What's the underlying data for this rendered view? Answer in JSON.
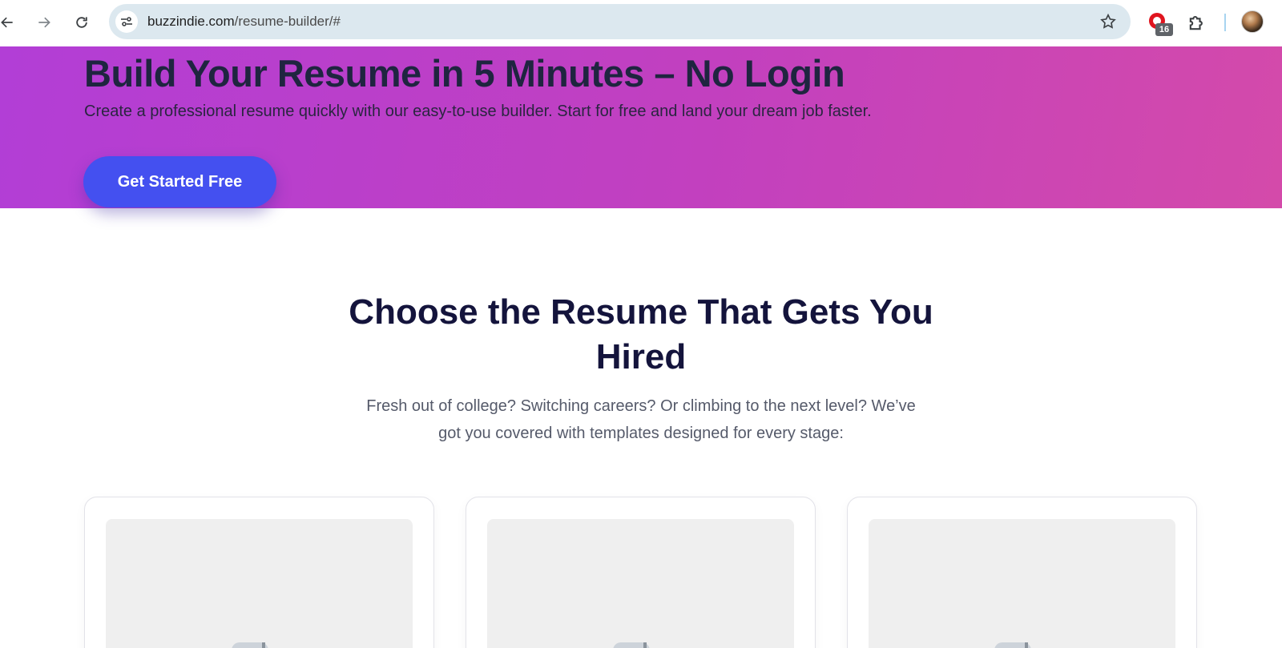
{
  "browser": {
    "url_host": "buzzindie.com",
    "url_path": "/resume-builder/#",
    "extension_badge_count": "16",
    "icons": [
      "back-arrow-icon",
      "forward-arrow-icon",
      "reload-icon",
      "site-info-icon",
      "bookmark-star-icon",
      "extension-icon",
      "extensions-puzzle-icon",
      "profile-avatar"
    ]
  },
  "hero": {
    "title": "Build Your Resume in 5 Minutes – No Login",
    "subtitle": "Create a professional resume quickly with our easy-to-use builder. Start for free and land your dream job faster.",
    "cta_label": "Get Started Free",
    "gradient_start": "#b23ed6",
    "gradient_end": "#d44aaa",
    "cta_color": "#4450f0"
  },
  "templates_section": {
    "title_line1": "Choose the Resume That Gets You",
    "title_line2": "Hired",
    "subtitle_line1": "Fresh out of college? Switching careers? Or climbing to the next level? We’ve",
    "subtitle_line2": "got you covered with templates designed for every stage:",
    "cards": [
      {
        "icon": "image-placeholder-icon"
      },
      {
        "icon": "image-placeholder-icon"
      },
      {
        "icon": "image-placeholder-icon"
      }
    ]
  }
}
